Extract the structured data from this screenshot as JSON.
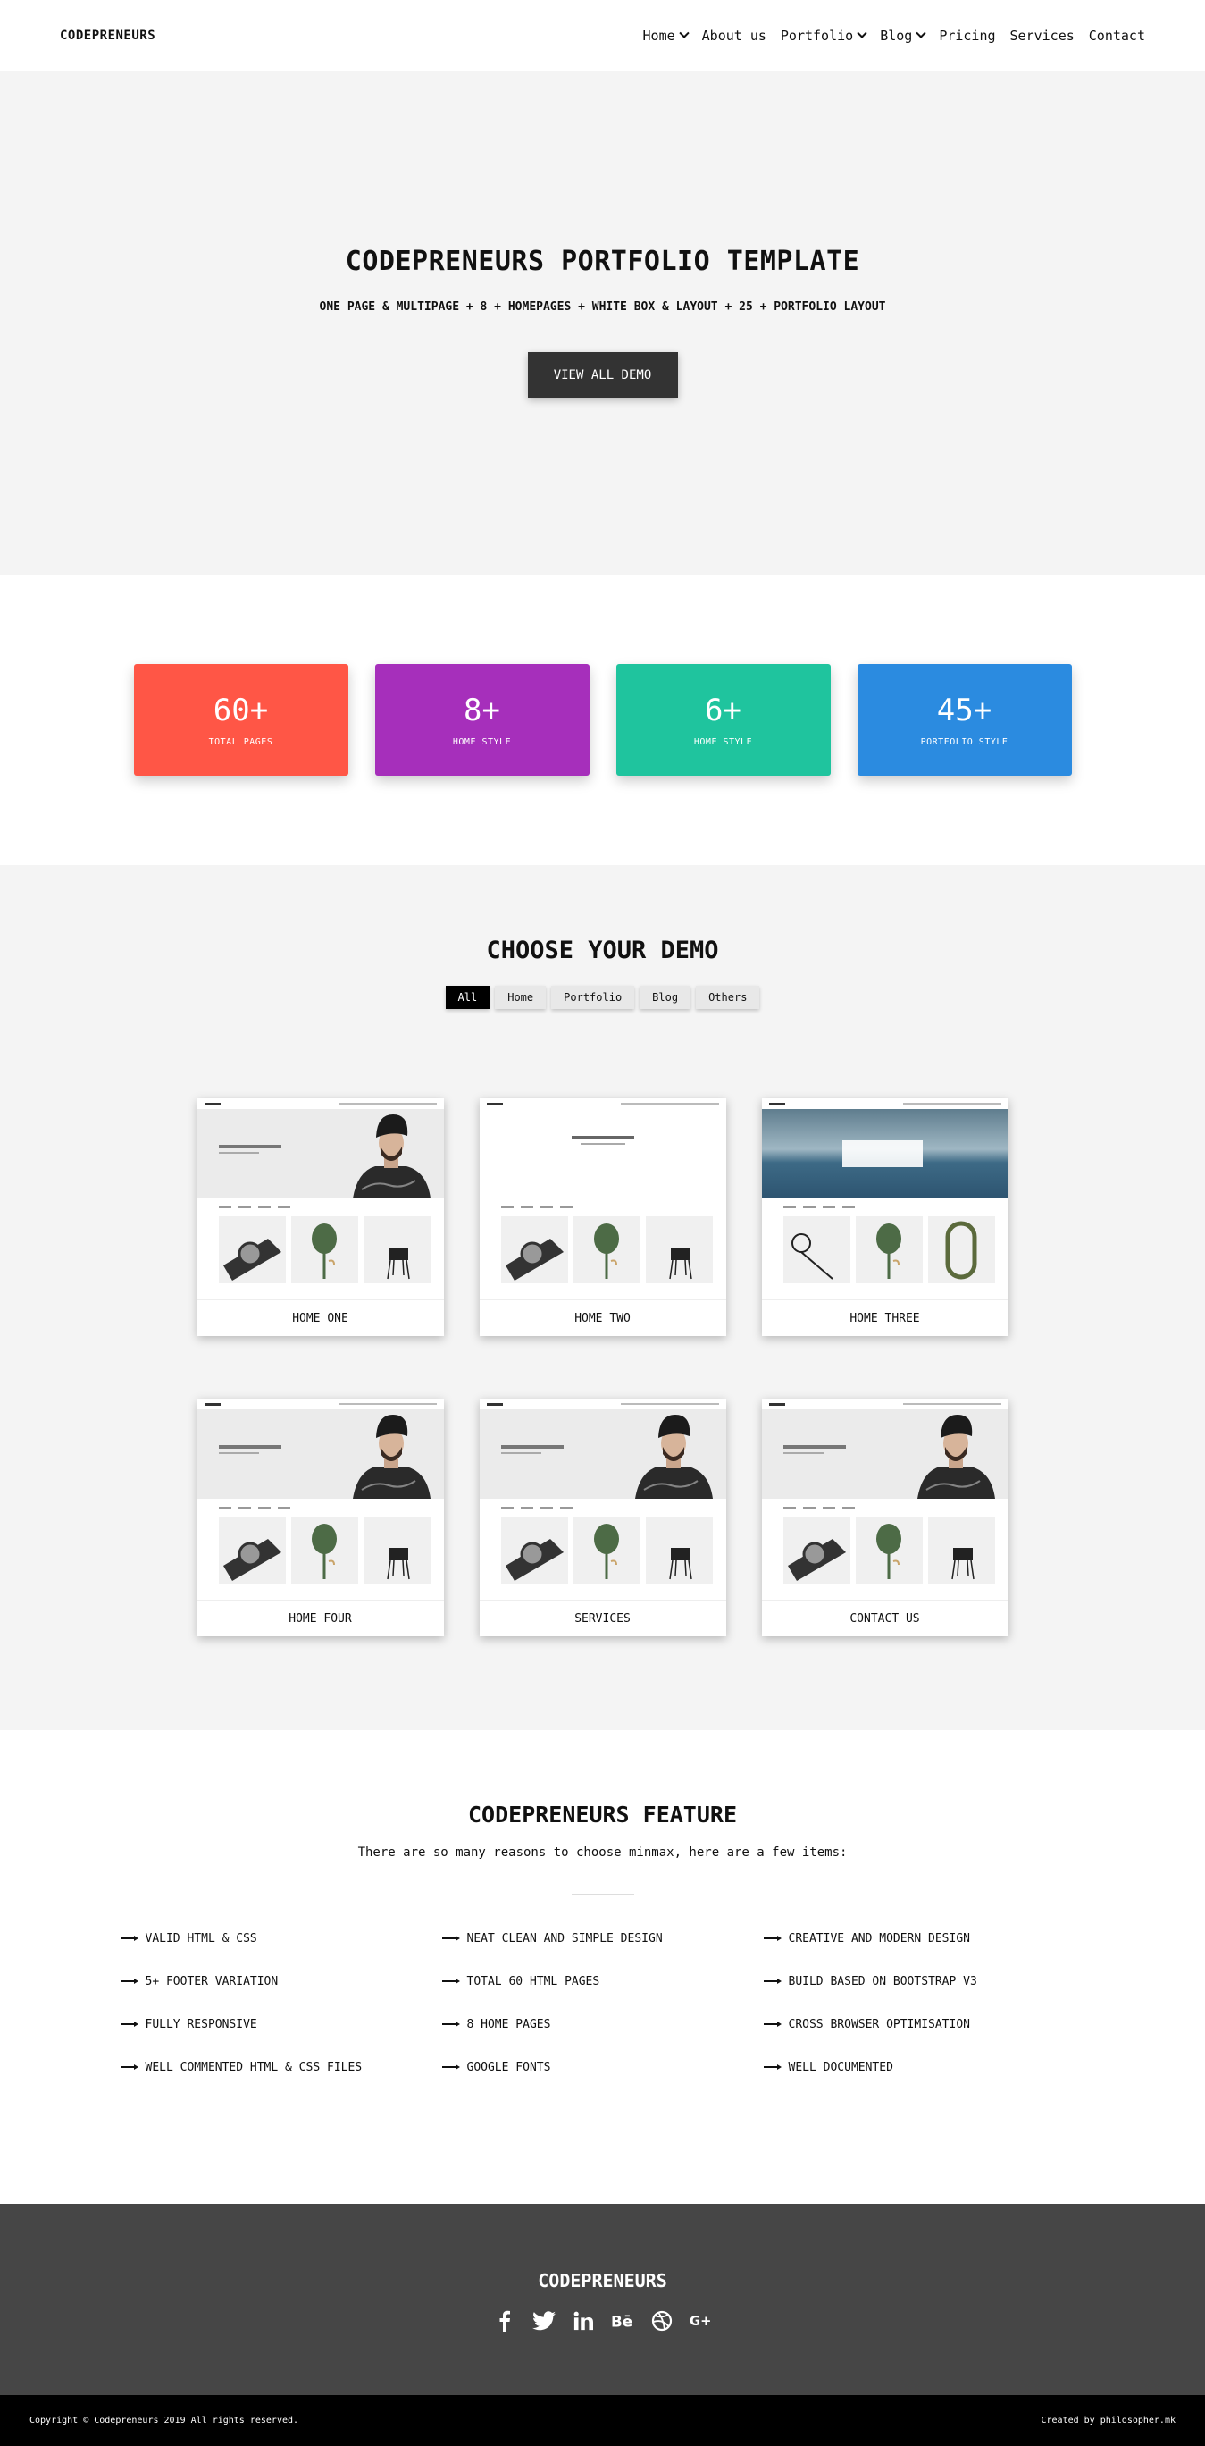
{
  "nav": {
    "brand": "CODEPRENEURS",
    "items": [
      {
        "label": "Home",
        "dropdown": true
      },
      {
        "label": "About us",
        "dropdown": false
      },
      {
        "label": "Portfolio",
        "dropdown": true
      },
      {
        "label": "Blog",
        "dropdown": true
      },
      {
        "label": "Pricing",
        "dropdown": false
      },
      {
        "label": "Services",
        "dropdown": false
      },
      {
        "label": "Contact",
        "dropdown": false
      }
    ]
  },
  "hero": {
    "title": "CODEPRENEURS PORTFOLIO TEMPLATE",
    "subtitle": "ONE PAGE & MULTIPAGE + 8 + HOMEPAGES + WHITE BOX & LAYOUT + 25 + PORTFOLIO LAYOUT",
    "button": "VIEW ALL DEMO"
  },
  "stats": [
    {
      "number": "60+",
      "label": "TOTAL PAGES",
      "color": "#ff5646"
    },
    {
      "number": "8+",
      "label": "HOME STYLE",
      "color": "#a62fbb"
    },
    {
      "number": "6+",
      "label": "HOME STYLE",
      "color": "#1fc49e"
    },
    {
      "number": "45+",
      "label": "PORTFOLIO STYLE",
      "color": "#2b8be0"
    }
  ],
  "demos": {
    "title": "CHOOSE YOUR DEMO",
    "filters": [
      "All",
      "Home",
      "Portfolio",
      "Blog",
      "Others"
    ],
    "active_filter": "All",
    "cards": [
      {
        "label": "HOME ONE",
        "variant": "person"
      },
      {
        "label": "HOME TWO",
        "variant": "two"
      },
      {
        "label": "HOME THREE",
        "variant": "sea"
      },
      {
        "label": "HOME FOUR",
        "variant": "person"
      },
      {
        "label": "SERVICES",
        "variant": "person"
      },
      {
        "label": "CONTACT US",
        "variant": "person"
      }
    ]
  },
  "features": {
    "title": "CODEPRENEURS FEATURE",
    "intro": "There are so many reasons to choose minmax, here are a few items:",
    "items": [
      "VALID HTML & CSS",
      "NEAT CLEAN AND SIMPLE DESIGN",
      "CREATIVE AND MODERN DESIGN",
      "5+ FOOTER VARIATION",
      "TOTAL 60 HTML PAGES",
      "BUILD BASED ON BOOTSTRAP V3",
      "FULLY RESPONSIVE",
      "8 HOME PAGES",
      "CROSS BROWSER OPTIMISATION",
      "WELL COMMENTED HTML & CSS FILES",
      "GOOGLE FONTS",
      "WELL DOCUMENTED"
    ]
  },
  "footer": {
    "brand": "CODEPRENEURS",
    "socials": [
      "facebook-icon",
      "twitter-icon",
      "linkedin-icon",
      "behance-icon",
      "dribbble-icon",
      "google-plus-icon"
    ],
    "copyright": "Copyright © Codepreneurs 2019 All rights reserved.",
    "credit": "Created by philosopher.mk"
  }
}
